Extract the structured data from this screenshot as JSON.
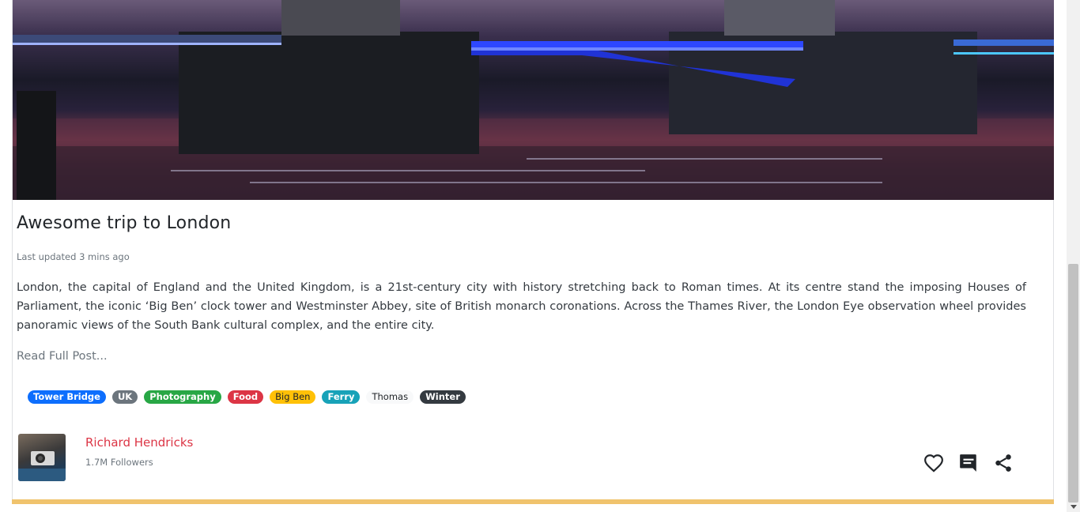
{
  "post": {
    "title": "Awesome trip to London",
    "updated": "Last updated 3 mins ago",
    "body": "London, the capital of England and the United Kingdom, is a 21st-century city with history stretching back to Roman times. At its centre stand the imposing Houses of Parliament, the iconic ‘Big Ben’ clock tower and Westminster Abbey, site of British monarch coronations. Across the Thames River, the London Eye observation wheel provides panoramic views of the South Bank cultural complex, and the entire city.",
    "read_more": "Read Full Post...",
    "tags": [
      {
        "label": "Tower Bridge",
        "color": "#0d6efd"
      },
      {
        "label": "UK",
        "color": "#6c757d"
      },
      {
        "label": "Photography",
        "color": "#28a745"
      },
      {
        "label": "Food",
        "color": "#dc3545"
      },
      {
        "label": "Big Ben",
        "color": "#ffc107"
      },
      {
        "label": "Ferry",
        "color": "#17a2b8"
      },
      {
        "label": "Thomas",
        "color": "#f8f9fa"
      },
      {
        "label": "Winter",
        "color": "#343a40"
      }
    ]
  },
  "author": {
    "name": "Richard Hendricks",
    "followers": "1.7M Followers"
  },
  "actions": [
    "heart-icon",
    "comment-icon",
    "share-icon"
  ],
  "colors": {
    "accent_bar": "#f0c36d",
    "author_link": "#dc3545"
  }
}
